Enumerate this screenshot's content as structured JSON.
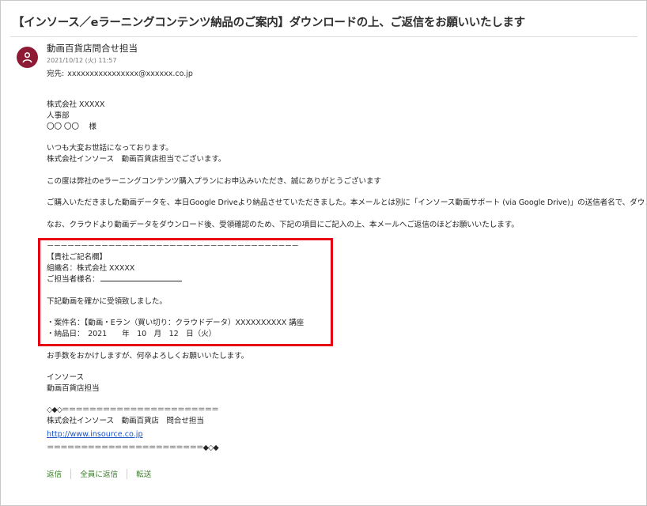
{
  "email": {
    "subject": "【インソース／eラーニングコンテンツ納品のご案内】ダウンロードの上、ご返信をお願いいたします",
    "sender": "動画百貨店問合せ担当",
    "date": "2021/10/12 (火) 11:57",
    "to_label": "宛先:",
    "to_value": "xxxxxxxxxxxxxxxx@xxxxxx.co.jp"
  },
  "body": {
    "company": "株式会社 XXXXX",
    "dept": "人事部",
    "name": "〇〇 〇〇　 様",
    "greeting1": "いつも大変お世話になっております。",
    "greeting2": "株式会社インソース　動画百貨店担当でございます。",
    "para1": "この度は弊社のeラーニングコンテンツ購入プランにお申込みいただき、誠にありがとうございます",
    "para2": "ご購入いただきました動画データを、本日Google Driveより納品させていただきました。本メールとは別に「インソース動画サポート (via Google Drive)」の送信者名で、ダウンロード方法等を記載し",
    "para3": "なお、クラウドより動画データをダウンロード後、受領確認のため、下記の項目にご記入の上、本メールへご返信のほどお願いいたします。",
    "dash_line": "－－－－－－－－－－－－－－－－－－－－－－－－－－－－－－－－－－－－－",
    "form_title": "【貴社ご記名欄】",
    "form_org": "組織名：株式会社 XXXXX",
    "form_person": "ご担当者様名：",
    "form_confirm": "下記動画を確かに受領致しました。",
    "form_item": "・案件名：【動画・Eラン（買い切り：クラウドデータ）XXXXXXXXXX 講座",
    "form_delivery": "・納品日：　2021　　年　10　月　12　日（火）",
    "closing": "お手数をおかけしますが、何卒よろしくお願いいたします。",
    "sig_company": "インソース",
    "sig_team": "動画百貨店担当",
    "sig_top_line": "◇◆◇＝＝＝＝＝＝＝＝＝＝＝＝＝＝＝＝＝＝＝＝＝＝＝",
    "sig_contact": "株式会社インソース　動画百貨店　問合せ担当",
    "sig_url": "http://www.insource.co.jp",
    "sig_bottom_line": "＝＝＝＝＝＝＝＝＝＝＝＝＝＝＝＝＝＝＝＝＝＝＝◆◇◆"
  },
  "actions": {
    "reply": "返信",
    "reply_all": "全員に返信",
    "forward": "転送"
  },
  "colors": {
    "avatar": "#8e1b35",
    "highlight": "#e60012",
    "action": "#3a7d2b",
    "link": "#1a55c9"
  },
  "icons": {
    "avatar": "person-icon"
  }
}
